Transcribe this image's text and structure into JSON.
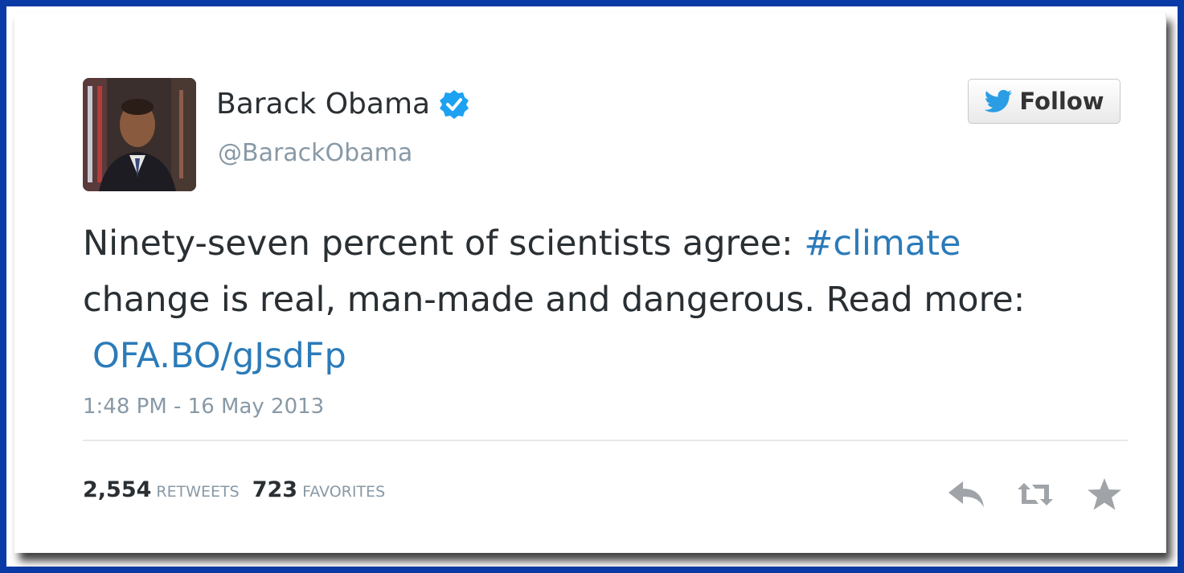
{
  "user": {
    "name": "Barack Obama",
    "handle": "@BarackObama"
  },
  "follow_button": {
    "label": "Follow",
    "icon": "twitter-bird-icon"
  },
  "tweet": {
    "line1_text": "Ninety-seven percent of scientists agree: ",
    "hashtag": "#climate",
    "line2_text": "change is real, man-made and dangerous. Read more:",
    "link": "OFA.BO/gJsdFp",
    "timestamp": "1:48 PM - 16 May 2013"
  },
  "stats": {
    "retweets_count": "2,554",
    "retweets_label": "Retweets",
    "favorites_count": "723",
    "favorites_label": "Favorites"
  },
  "actions": {
    "reply_icon": "reply-icon",
    "retweet_icon": "retweet-icon",
    "favorite_icon": "star-icon"
  },
  "colors": {
    "background": "#0a3aa6",
    "link": "#2b7bb9",
    "muted": "#8899a6",
    "verified": "#1da1f2",
    "text": "#292f33"
  }
}
